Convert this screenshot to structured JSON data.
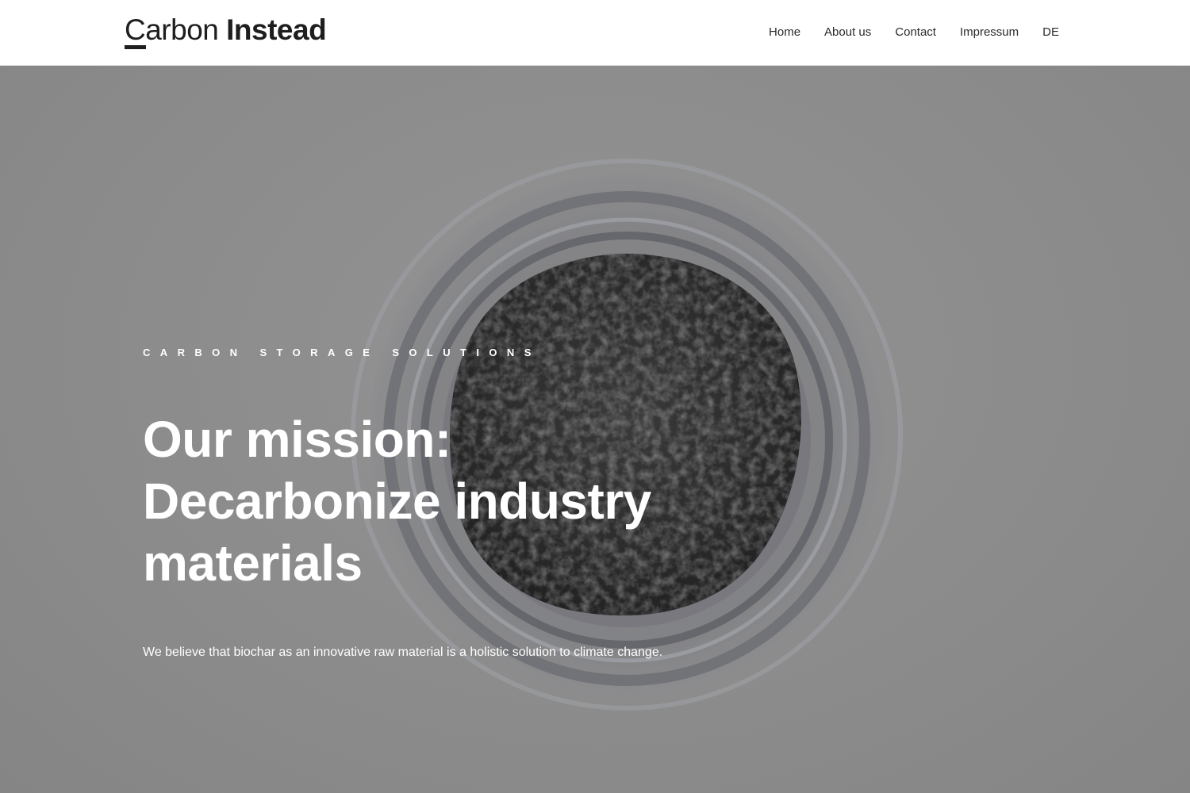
{
  "header": {
    "logo": {
      "light": "Carbon",
      "bold": "Instead"
    },
    "nav": [
      {
        "label": "Home"
      },
      {
        "label": "About us"
      },
      {
        "label": "Contact"
      },
      {
        "label": "Impressum"
      },
      {
        "label": "DE"
      }
    ]
  },
  "hero": {
    "eyebrow": "CARBON STORAGE SOLUTIONS",
    "headline_lines": [
      "Our mission:",
      "Decarbonize industry",
      "materials"
    ],
    "tagline": "We believe that biochar as an innovative raw material is a holistic solution to climate change."
  },
  "colors": {
    "header_bg": "#ffffff",
    "hero_overlay": "#8c8c8c",
    "text_on_hero": "#ffffff",
    "logo": "#1e1e1e"
  }
}
